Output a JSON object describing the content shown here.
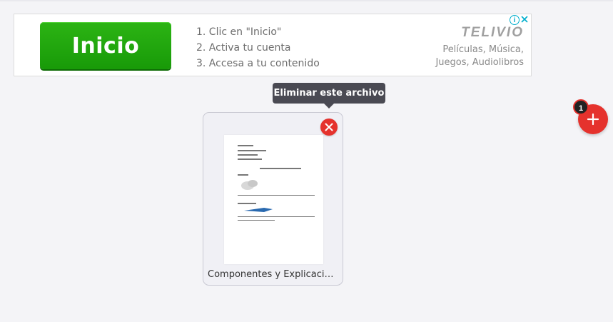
{
  "ad": {
    "button_label": "Inicio",
    "steps": [
      "1. Clic en \"Inicio\"",
      "2. Activa tu cuenta",
      "3. Accesa a tu contenido"
    ],
    "brand": "TELIVIO",
    "tagline_1": "Películas, Música,",
    "tagline_2": "Juegos, Audiolibros",
    "info_icon": "i"
  },
  "tooltip": {
    "text": "Eliminar este archivo"
  },
  "file": {
    "name": "Componentes y Explicacion de..."
  },
  "add": {
    "count": "1"
  },
  "colors": {
    "accent": "#e5322d",
    "ad_green": "#1fa50d",
    "tooltip_bg": "#4a4a53"
  }
}
